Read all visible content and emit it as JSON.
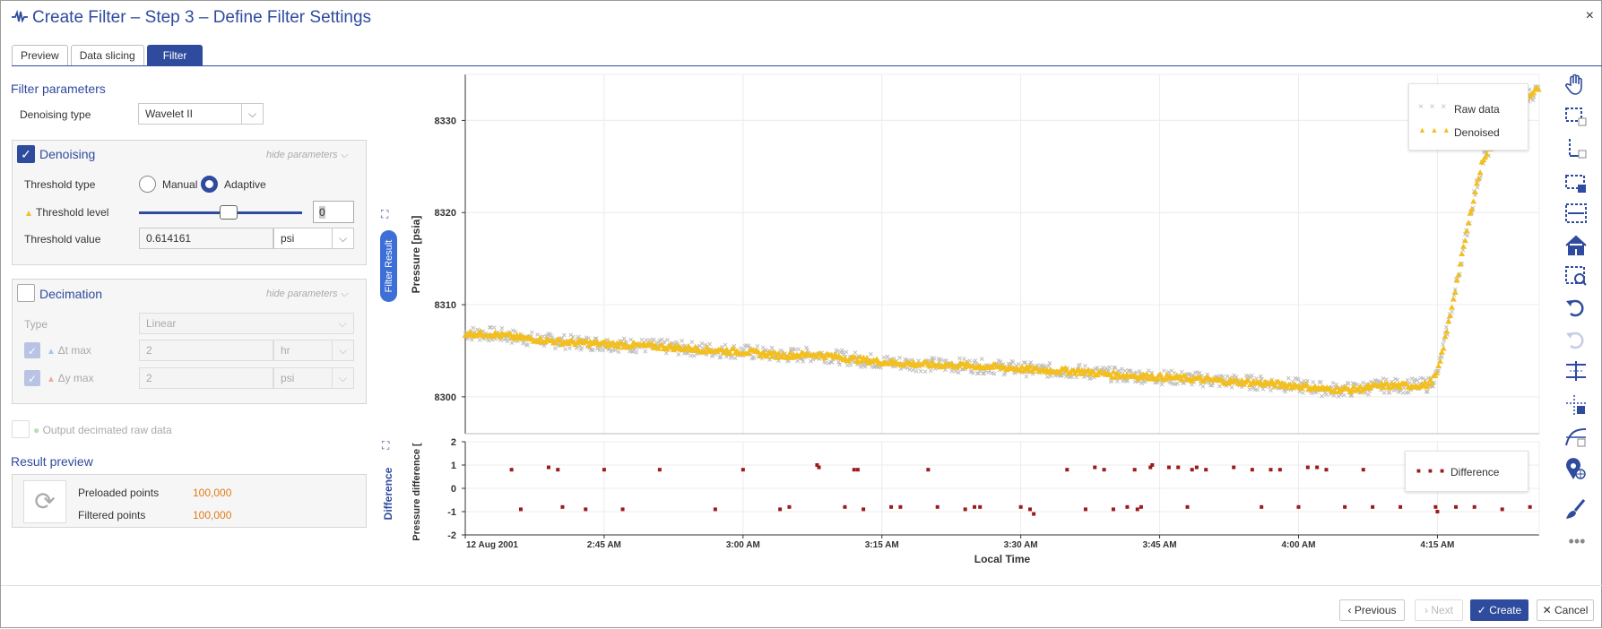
{
  "window": {
    "title": "Create Filter – Step 3 – Define Filter Settings",
    "close": "×"
  },
  "tabs": [
    {
      "label": "Preview"
    },
    {
      "label": "Data slicing"
    },
    {
      "label": "Filter"
    }
  ],
  "filter_parameters": {
    "title": "Filter parameters",
    "denoising_type_label": "Denoising type",
    "denoising_type_value": "Wavelet II"
  },
  "denoising": {
    "title": "Denoising",
    "hide": "hide parameters",
    "threshold_type_label": "Threshold type",
    "manual": "Manual",
    "adaptive": "Adaptive",
    "threshold_level_label": "Threshold level",
    "threshold_level_value": "0",
    "threshold_level_slider": 0.55,
    "threshold_value_label": "Threshold value",
    "threshold_value": "0.614161",
    "threshold_unit": "psi"
  },
  "decimation": {
    "title": "Decimation",
    "hide": "hide parameters",
    "type_label": "Type",
    "type_value": "Linear",
    "dt_label": "Δt max",
    "dt_value": "2",
    "dt_unit": "hr",
    "dy_label": "Δy max",
    "dy_value": "2",
    "dy_unit": "psi",
    "output_label": "Output decimated raw data"
  },
  "result_preview": {
    "title": "Result preview",
    "preloaded_label": "Preloaded points",
    "preloaded_value": "100,000",
    "filtered_label": "Filtered points",
    "filtered_value": "100,000"
  },
  "side_tab": "Filter Result",
  "diff_side_label": "Difference",
  "footer": {
    "previous": "Previous",
    "next": "Next",
    "create": "Create",
    "cancel": "Cancel"
  },
  "colors": {
    "accent": "#2f4b9e",
    "denoised": "#f3bf1f",
    "raw": "#bdbdbd",
    "difference": "#9b1b1b",
    "orange": "#e07b1a"
  },
  "toolbar_icons": [
    "hand-pan-icon",
    "box-zoom-icon",
    "x-zoom-icon",
    "select-box-icon",
    "select-x-icon",
    "home-icon",
    "zoom-fit-icon",
    "undo-icon",
    "redo-icon",
    "crosshair-lines-icon",
    "point-select-icon",
    "curve-select-icon",
    "marker-add-icon",
    "brush-icon",
    "more-icon"
  ],
  "chart_data": [
    {
      "type": "scatter",
      "ylabel": "Pressure [psia]",
      "yticks": [
        8300,
        8310,
        8320,
        8330
      ],
      "ylim": [
        8296,
        8335
      ],
      "xlim_minutes": [
        150,
        266
      ],
      "xlabel": "Local Time",
      "xticks": [
        {
          "t": 150,
          "label": "12 Aug 2001"
        },
        {
          "t": 165,
          "label": "2:45 AM"
        },
        {
          "t": 180,
          "label": "3:00 AM"
        },
        {
          "t": 195,
          "label": "3:15 AM"
        },
        {
          "t": 210,
          "label": "3:30 AM"
        },
        {
          "t": 225,
          "label": "3:45 AM"
        },
        {
          "t": 240,
          "label": "4:00 AM"
        },
        {
          "t": 255,
          "label": "4:15 AM"
        }
      ],
      "series": [
        {
          "name": "Raw data",
          "marker": "x"
        },
        {
          "name": "Denoised",
          "marker": "triangle",
          "points": [
            [
              150,
              8306.9
            ],
            [
              153,
              8306.8
            ],
            [
              156,
              8306.4
            ],
            [
              160,
              8306.0
            ],
            [
              164,
              8305.8
            ],
            [
              168,
              8305.6
            ],
            [
              172,
              8305.4
            ],
            [
              176,
              8305.1
            ],
            [
              180,
              8304.9
            ],
            [
              184,
              8304.5
            ],
            [
              188,
              8304.6
            ],
            [
              192,
              8304.1
            ],
            [
              196,
              8303.7
            ],
            [
              200,
              8303.5
            ],
            [
              204,
              8303.4
            ],
            [
              208,
              8303.2
            ],
            [
              212,
              8302.9
            ],
            [
              216,
              8302.8
            ],
            [
              220,
              8302.4
            ],
            [
              224,
              8302.2
            ],
            [
              228,
              8302.0
            ],
            [
              232,
              8301.7
            ],
            [
              236,
              8301.5
            ],
            [
              240,
              8301.2
            ],
            [
              243,
              8300.8
            ],
            [
              246,
              8300.8
            ],
            [
              249,
              8301.2
            ],
            [
              252,
              8301.2
            ],
            [
              254,
              8301.3
            ],
            [
              255,
              8302.5
            ],
            [
              256,
              8307.0
            ],
            [
              257,
              8312.0
            ],
            [
              258,
              8317.0
            ],
            [
              259,
              8322.0
            ],
            [
              260,
              8326.0
            ],
            [
              262,
              8329.0
            ],
            [
              264,
              8332.0
            ],
            [
              266,
              8333.5
            ]
          ]
        }
      ]
    },
    {
      "type": "scatter",
      "ylabel": "Pressure difference [",
      "yticks": [
        -2,
        -1,
        0,
        1,
        2
      ],
      "ylim": [
        -2,
        2
      ],
      "series": [
        {
          "name": "Difference",
          "points": [
            [
              155,
              0.8
            ],
            [
              156,
              -0.9
            ],
            [
              159,
              0.9
            ],
            [
              160,
              0.8
            ],
            [
              160.5,
              -0.8
            ],
            [
              163,
              -0.9
            ],
            [
              165,
              0.8
            ],
            [
              167,
              -0.9
            ],
            [
              171,
              0.8
            ],
            [
              177,
              -0.9
            ],
            [
              180,
              0.8
            ],
            [
              184,
              -0.9
            ],
            [
              185,
              -0.8
            ],
            [
              188,
              1.0
            ],
            [
              188.2,
              0.9
            ],
            [
              191,
              -0.8
            ],
            [
              192,
              0.8
            ],
            [
              192.4,
              0.8
            ],
            [
              193,
              -0.9
            ],
            [
              196,
              -0.8
            ],
            [
              197,
              -0.8
            ],
            [
              200,
              0.8
            ],
            [
              201,
              -0.8
            ],
            [
              204,
              -0.9
            ],
            [
              205,
              -0.8
            ],
            [
              205.6,
              -0.8
            ],
            [
              210,
              -0.8
            ],
            [
              211,
              -0.9
            ],
            [
              211.4,
              -1.1
            ],
            [
              215,
              0.8
            ],
            [
              217,
              -0.9
            ],
            [
              218,
              0.9
            ],
            [
              219,
              0.8
            ],
            [
              220,
              -0.9
            ],
            [
              221.5,
              -0.8
            ],
            [
              222.3,
              0.8
            ],
            [
              222.6,
              -0.9
            ],
            [
              223,
              -0.8
            ],
            [
              224,
              0.9
            ],
            [
              224.2,
              1.0
            ],
            [
              226,
              0.9
            ],
            [
              227,
              0.9
            ],
            [
              228,
              -0.8
            ],
            [
              228.5,
              0.8
            ],
            [
              229,
              0.9
            ],
            [
              230,
              0.8
            ],
            [
              233,
              0.9
            ],
            [
              235,
              0.8
            ],
            [
              236,
              -0.8
            ],
            [
              237,
              0.8
            ],
            [
              238,
              0.8
            ],
            [
              240,
              -0.8
            ],
            [
              241,
              0.9
            ],
            [
              242,
              0.9
            ],
            [
              243,
              0.8
            ],
            [
              245,
              -0.8
            ],
            [
              247,
              0.8
            ],
            [
              248,
              -0.8
            ],
            [
              251,
              -0.8
            ],
            [
              252,
              0.8
            ],
            [
              255,
              -1.0
            ],
            [
              254.8,
              -0.8
            ],
            [
              257,
              -0.8
            ],
            [
              258,
              0.8
            ],
            [
              259,
              -0.8
            ],
            [
              262,
              -0.9
            ],
            [
              264,
              0.8
            ],
            [
              265,
              -0.8
            ]
          ]
        }
      ]
    }
  ]
}
